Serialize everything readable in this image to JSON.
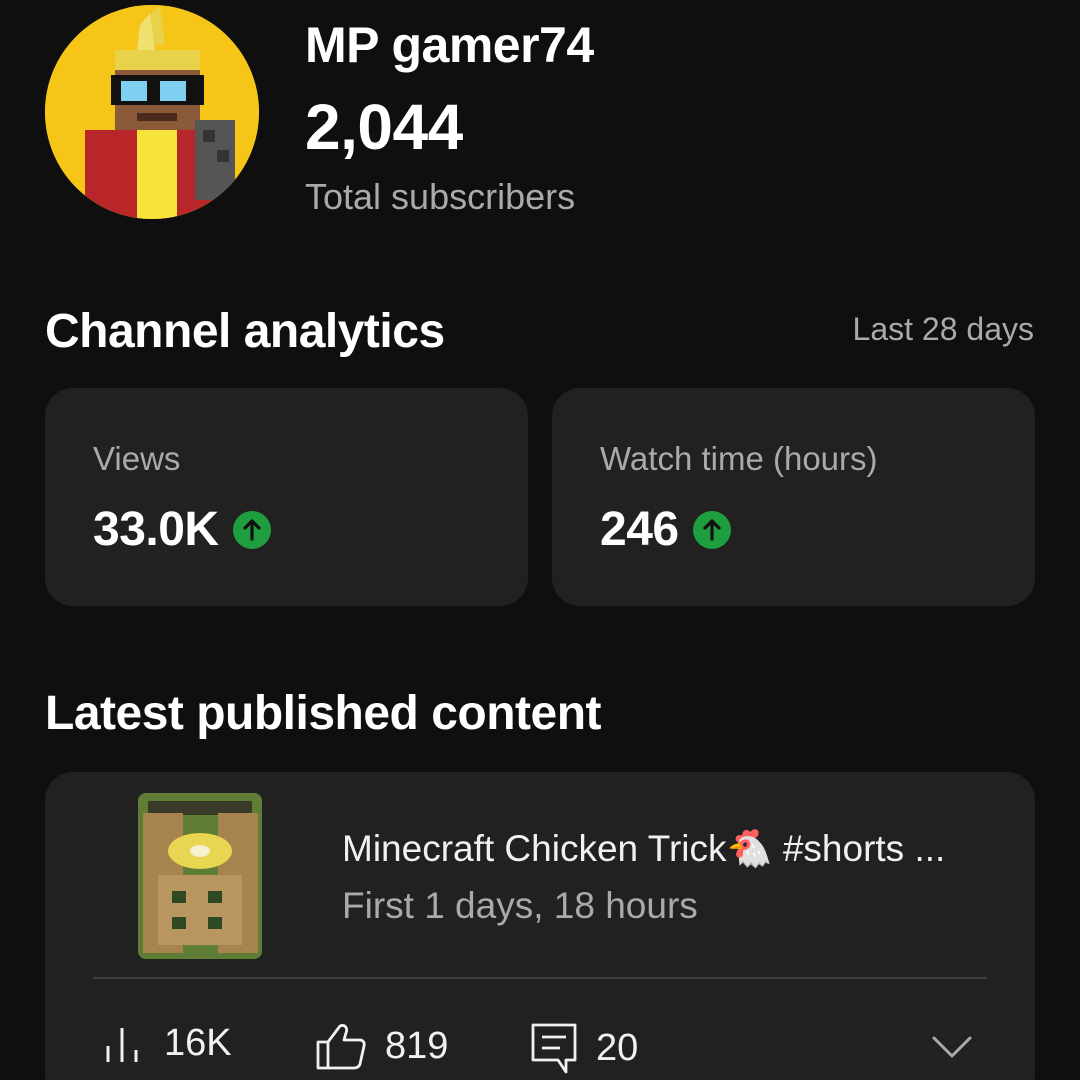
{
  "channel": {
    "name": "MP gamer74",
    "subscribers": "2,044",
    "subscribers_label": "Total subscribers",
    "avatar_icon": "minecraft-avatar"
  },
  "analytics": {
    "title": "Channel analytics",
    "range": "Last 28 days",
    "metrics": [
      {
        "label": "Views",
        "value": "33.0K",
        "trend": "up"
      },
      {
        "label": "Watch time (hours)",
        "value": "246",
        "trend": "up"
      }
    ],
    "trend_color": "#1e9e3e"
  },
  "latest": {
    "title": "Latest published content",
    "video": {
      "title": "Minecraft Chicken Trick🐔 #shorts ...",
      "age": "First 1 days, 18 hours",
      "views": "16K",
      "likes": "819",
      "comments": "20"
    }
  },
  "colors": {
    "background": "#0f0f0f",
    "card": "#212121",
    "secondary_text": "#aaaaaa"
  }
}
